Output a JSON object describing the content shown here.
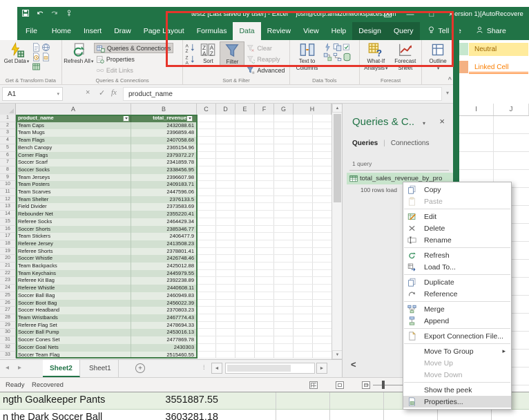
{
  "colors": {
    "excel_green": "#217346",
    "annotation_red": "#e6352b",
    "table_header_green": "#588457",
    "band_dark": "#d2e0d1",
    "band_light": "#e5ece3",
    "selected_query_green": "#c8e4cc",
    "neutral_style_bg": "#ffeb9c",
    "neutral_style_fg": "#9c6500",
    "linked_cell_fg": "#fa7d00"
  },
  "icons": {
    "close": "×",
    "minimize": "—",
    "restore": "□",
    "caret": "▾",
    "submenu_arrow": "▸",
    "tab_nav_left": "◂",
    "tab_nav_right": "▸",
    "hscroll_left": "◄",
    "hscroll_right": "►",
    "pane_scroll_left": "<",
    "scroll_up": "▲",
    "scroll_down": "▼",
    "collapse_ribbon": "^",
    "add_sheet": "+",
    "formula_cancel": "×",
    "formula_enter": "✓",
    "fx": "fx",
    "pane_dots": "⁞"
  },
  "title_bar": {
    "title": "test2 [Last saved by user] - Excel",
    "account": "josh@corp.amazonworkspaces.com",
    "background_window_title": "ersion 1)[AutoRecovere"
  },
  "tabs": {
    "items": [
      {
        "label": "File",
        "file": true
      },
      {
        "label": "Home"
      },
      {
        "label": "Insert"
      },
      {
        "label": "Draw"
      },
      {
        "label": "Page Layout"
      },
      {
        "label": "Formulas"
      },
      {
        "label": "Data",
        "active": true
      },
      {
        "label": "Review"
      },
      {
        "label": "View"
      },
      {
        "label": "Help"
      },
      {
        "label": "Design",
        "tool": true
      },
      {
        "label": "Query",
        "tool": true
      }
    ],
    "tell_me": "Tell me",
    "share": "Share"
  },
  "ribbon": {
    "get_data": "Get Data",
    "refresh_all": "Refresh All",
    "queries_connections": "Queries & Connections",
    "properties": "Properties",
    "edit_links": "Edit Links",
    "sort": "Sort",
    "filter": "Filter",
    "clear": "Clear",
    "reapply": "Reapply",
    "advanced": "Advanced",
    "text_to_columns": "Text to Columns",
    "what_if": "What-If Analysis",
    "forecast_sheet": "Forecast Sheet",
    "outline": "Outline",
    "groups": [
      "Get & Transform Data",
      "Queries & Connections",
      "Sort & Filter",
      "Data Tools",
      "Forecast",
      "Outline"
    ],
    "small_icons_gtd": [
      "from-text-csv",
      "from-web",
      "recent-sources",
      "existing-connections",
      "from-table-range"
    ],
    "small_icons_dt": [
      "flash-fill",
      "remove-duplicates",
      "data-validation",
      "consolidate",
      "relationships",
      "manage-data-model"
    ]
  },
  "formula_bar": {
    "cell_ref": "A1",
    "formula": "product_name"
  },
  "grid": {
    "columns": [
      "A",
      "B",
      "C",
      "D",
      "E",
      "F",
      "G",
      "H"
    ],
    "row_count": 33,
    "table": {
      "headers": [
        "product_name",
        "total_revenue"
      ],
      "rows": [
        [
          "Team Caps",
          "2432088.61"
        ],
        [
          "Team Mugs",
          "2396859.48"
        ],
        [
          "Team Flags",
          "2407058.68"
        ],
        [
          "Bench Canopy",
          "2365154.96"
        ],
        [
          "Corner Flags",
          "2379372.27"
        ],
        [
          "Soccer Scarf",
          "2341859.78"
        ],
        [
          "Soccer Socks",
          "2338456.95"
        ],
        [
          "Team Jerseys",
          "2396607.98"
        ],
        [
          "Team Posters",
          "2409183.71"
        ],
        [
          "Team Scarves",
          "2447596.06"
        ],
        [
          "Team Shelter",
          "2376133.5"
        ],
        [
          "Field Divider",
          "2373583.69"
        ],
        [
          "Rebounder Net",
          "2355220.41"
        ],
        [
          "Referee Socks",
          "2464429.34"
        ],
        [
          "Soccer Shorts",
          "2385346.77"
        ],
        [
          "Team Stickers",
          "2406477.9"
        ],
        [
          "Referee Jersey",
          "2413508.23"
        ],
        [
          "Referee Shorts",
          "2378801.41"
        ],
        [
          "Soccer Whistle",
          "2426748.46"
        ],
        [
          "Team Backpacks",
          "2425012.88"
        ],
        [
          "Team Keychains",
          "2445979.55"
        ],
        [
          "Referee Kit Bag",
          "2392238.89"
        ],
        [
          "Referee Whistle",
          "2440608.11"
        ],
        [
          "Soccer Ball Bag",
          "2460949.83"
        ],
        [
          "Soccer Boot Bag",
          "2456022.39"
        ],
        [
          "Soccer Headband",
          "2370803.23"
        ],
        [
          "Team Wristbands",
          "2467774.43"
        ],
        [
          "Referee Flag Set",
          "2478694.33"
        ],
        [
          "Soccer Ball Pump",
          "2453016.13"
        ],
        [
          "Soccer Cones Set",
          "2477869.78"
        ],
        [
          "Soccer Goal Nets",
          "2430303"
        ],
        [
          "Soccer Team Flag",
          "2515460.55"
        ]
      ]
    }
  },
  "sheet_tabs": [
    {
      "name": "Sheet2",
      "active": true
    },
    {
      "name": "Sheet1",
      "active": false
    }
  ],
  "status_bar": {
    "ready": "Ready",
    "recovered": "Recovered"
  },
  "queries_pane": {
    "title": "Queries & C..",
    "tab_queries": "Queries",
    "tab_connections": "Connections",
    "count_label": "1 query",
    "query_name": "total_sales_revenue_by_pro",
    "query_sub": "100 rows load"
  },
  "context_menu": {
    "items": [
      {
        "label": "Copy",
        "icon": "copy"
      },
      {
        "label": "Paste",
        "icon": "paste",
        "enabled": false
      },
      {
        "sep": true
      },
      {
        "label": "Edit",
        "icon": "edit"
      },
      {
        "label": "Delete",
        "icon": "delete"
      },
      {
        "label": "Rename",
        "icon": "rename"
      },
      {
        "sep": true
      },
      {
        "label": "Refresh",
        "icon": "refresh"
      },
      {
        "label": "Load To...",
        "icon": "load-to"
      },
      {
        "sep": true
      },
      {
        "label": "Duplicate",
        "icon": "duplicate"
      },
      {
        "label": "Reference",
        "icon": "reference"
      },
      {
        "sep": true
      },
      {
        "label": "Merge",
        "icon": "merge"
      },
      {
        "label": "Append",
        "icon": "append"
      },
      {
        "sep": true
      },
      {
        "label": "Export Connection File...",
        "icon": "export"
      },
      {
        "sep": true
      },
      {
        "label": "Move To Group",
        "submenu": true
      },
      {
        "label": "Move Up",
        "enabled": false
      },
      {
        "label": "Move Down",
        "enabled": false
      },
      {
        "sep": true
      },
      {
        "label": "Show the peek"
      },
      {
        "label": "Properties...",
        "icon": "properties",
        "hover": true
      }
    ]
  },
  "bg_window": {
    "style_chips": [
      "Neutral",
      "Linked Cell"
    ],
    "columns": [
      "I",
      "J"
    ],
    "bottom_rows": [
      [
        "ngth Goalkeeper Pants",
        "3551887.55"
      ],
      [
        "n the Dark Soccer Ball",
        "3603281.18"
      ]
    ]
  }
}
